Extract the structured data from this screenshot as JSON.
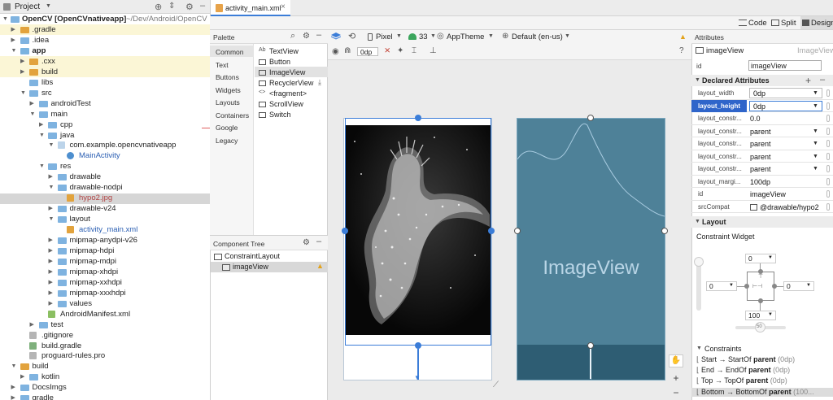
{
  "project_panel": {
    "title": "Project",
    "root_label": "OpenCV [OpenCVnativeapp]",
    "root_path": "~/Dev/Android/OpenCV",
    "items": [
      {
        "label": ".gradle",
        "bold": false,
        "sub": ""
      },
      {
        "label": ".idea",
        "bold": false,
        "sub": ""
      },
      {
        "label": "app",
        "bold": true,
        "sub": ""
      },
      {
        "label": ".cxx",
        "bold": false,
        "sub": ""
      },
      {
        "label": "build",
        "bold": false,
        "sub": ""
      },
      {
        "label": "libs",
        "bold": false,
        "sub": ""
      },
      {
        "label": "src",
        "bold": false,
        "sub": ""
      },
      {
        "label": "androidTest",
        "bold": false,
        "sub": ""
      },
      {
        "label": "main",
        "bold": false,
        "sub": ""
      },
      {
        "label": "cpp",
        "bold": false,
        "sub": ""
      },
      {
        "label": "java",
        "bold": false,
        "sub": ""
      },
      {
        "label": "com.example.opencvnativeapp",
        "bold": false,
        "sub": ""
      },
      {
        "label": "MainActivity",
        "bold": false,
        "sub": ""
      },
      {
        "label": "res",
        "bold": false,
        "sub": ""
      },
      {
        "label": "drawable",
        "bold": false,
        "sub": ""
      },
      {
        "label": "drawable-nodpi",
        "bold": false,
        "sub": ""
      },
      {
        "label": "hypo2.jpg",
        "bold": false,
        "sub": ""
      },
      {
        "label": "drawable-v24",
        "bold": false,
        "sub": ""
      },
      {
        "label": "layout",
        "bold": false,
        "sub": ""
      },
      {
        "label": "activity_main.xml",
        "bold": false,
        "sub": ""
      },
      {
        "label": "mipmap-anydpi-v26",
        "bold": false,
        "sub": ""
      },
      {
        "label": "mipmap-hdpi",
        "bold": false,
        "sub": ""
      },
      {
        "label": "mipmap-mdpi",
        "bold": false,
        "sub": ""
      },
      {
        "label": "mipmap-xhdpi",
        "bold": false,
        "sub": ""
      },
      {
        "label": "mipmap-xxhdpi",
        "bold": false,
        "sub": ""
      },
      {
        "label": "mipmap-xxxhdpi",
        "bold": false,
        "sub": ""
      },
      {
        "label": "values",
        "bold": false,
        "sub": ""
      },
      {
        "label": "AndroidManifest.xml",
        "bold": false,
        "sub": ""
      },
      {
        "label": "test",
        "bold": false,
        "sub": ""
      },
      {
        "label": ".gitignore",
        "bold": false,
        "sub": ""
      },
      {
        "label": "build.gradle",
        "bold": false,
        "sub": ""
      },
      {
        "label": "proguard-rules.pro",
        "bold": false,
        "sub": ""
      },
      {
        "label": "build",
        "bold": false,
        "sub": ""
      },
      {
        "label": "kotlin",
        "bold": false,
        "sub": ""
      },
      {
        "label": "DocsImgs",
        "bold": false,
        "sub": ""
      },
      {
        "label": "gradle",
        "bold": false,
        "sub": ""
      }
    ]
  },
  "editor_tab": {
    "label": "activity_main.xml"
  },
  "view_modes": {
    "code": "Code",
    "split": "Split",
    "design": "Design"
  },
  "palette": {
    "title": "Palette",
    "categories": [
      "Common",
      "Text",
      "Buttons",
      "Widgets",
      "Layouts",
      "Containers",
      "Google",
      "Legacy"
    ],
    "items": [
      {
        "icon": "Ab",
        "label": "TextView"
      },
      {
        "icon": "",
        "label": "Button"
      },
      {
        "icon": "",
        "label": "ImageView"
      },
      {
        "icon": "",
        "label": "RecyclerView"
      },
      {
        "icon": "<>",
        "label": "<fragment>"
      },
      {
        "icon": "",
        "label": "ScrollView"
      },
      {
        "icon": "",
        "label": "Switch"
      }
    ]
  },
  "component_tree": {
    "title": "Component Tree",
    "items": [
      {
        "label": "ConstraintLayout"
      },
      {
        "label": "imageView"
      }
    ]
  },
  "design_toolbar": {
    "device": "Pixel",
    "api": "33",
    "theme": "AppTheme",
    "locale": "Default (en-us)",
    "margin": "0dp"
  },
  "blueprint": {
    "label": "ImageView"
  },
  "attributes": {
    "title": "Attributes",
    "component_name": "imageView",
    "component_type": "ImageView",
    "id_label": "id",
    "id_value": "imageView",
    "declared_title": "Declared Attributes",
    "rows": [
      {
        "name": "layout_width",
        "value": "0dp"
      },
      {
        "name": "layout_height",
        "value": "0dp"
      },
      {
        "name": "layout_constr...",
        "value": "0.0"
      },
      {
        "name": "layout_constr...",
        "value": "parent"
      },
      {
        "name": "layout_constr...",
        "value": "parent"
      },
      {
        "name": "layout_constr...",
        "value": "parent"
      },
      {
        "name": "layout_constr...",
        "value": "parent"
      },
      {
        "name": "layout_margi...",
        "value": "100dp"
      },
      {
        "name": "id",
        "value": "imageView"
      },
      {
        "name": "srcCompat",
        "value": "@drawable/hypo2"
      }
    ],
    "layout_title": "Layout",
    "constraint_widget_label": "Constraint Widget",
    "cw_top": "0",
    "cw_left": "0",
    "cw_right": "0",
    "cw_bottom": "100",
    "cw_bias": "50",
    "constraints_title": "Constraints",
    "constraints": [
      {
        "from": "Start",
        "to": "StartOf",
        "target": "parent",
        "value": "(0dp)"
      },
      {
        "from": "End",
        "to": "EndOf",
        "target": "parent",
        "value": "(0dp)"
      },
      {
        "from": "Top",
        "to": "TopOf",
        "target": "parent",
        "value": "(0dp)"
      },
      {
        "from": "Bottom",
        "to": "BottomOf",
        "target": "parent",
        "value": "(100..."
      }
    ]
  }
}
